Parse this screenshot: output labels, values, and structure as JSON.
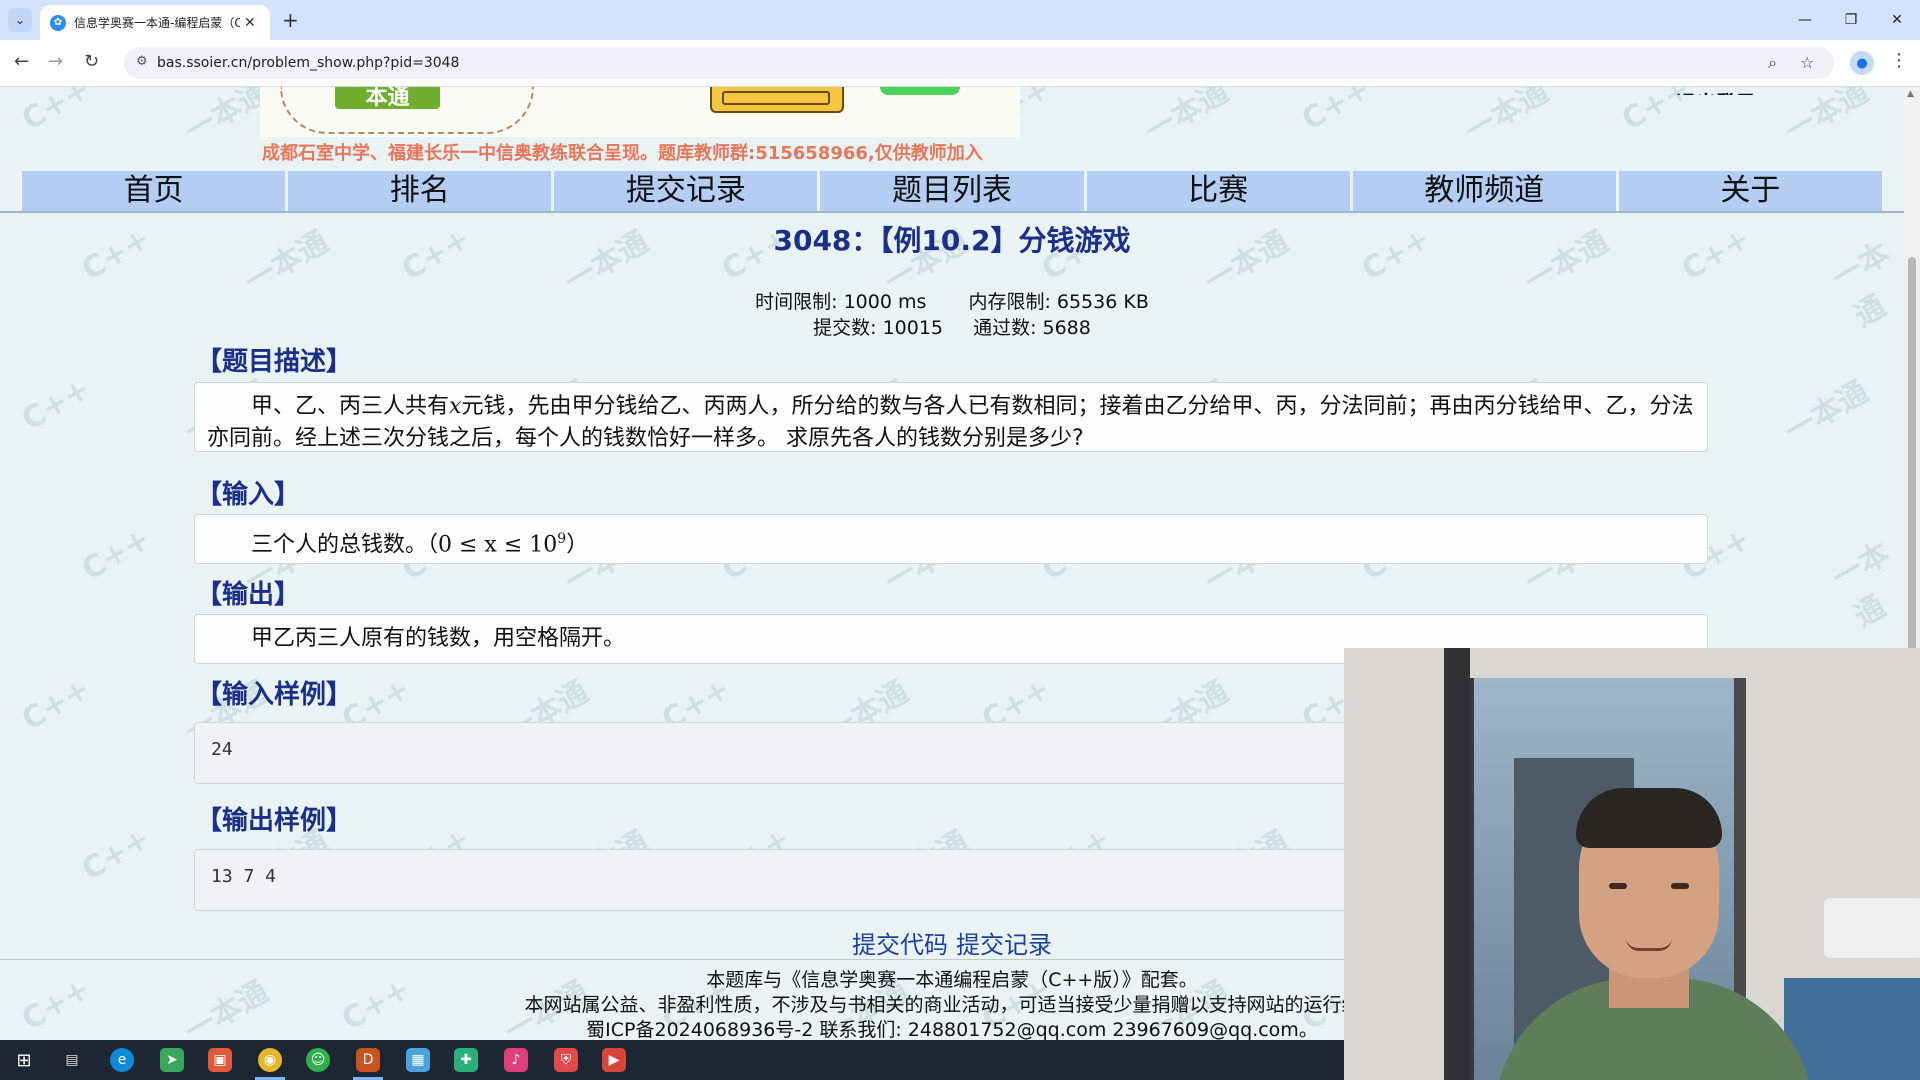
{
  "browser": {
    "tab_title": "信息学奥赛一本通-编程启蒙（C",
    "url": "bas.ssoier.cn/problem_show.php?pid=3048"
  },
  "banner": {
    "logo_text": "本通",
    "logout": "退出登录",
    "notice": "成都石室中学、福建长乐一中信奥教练联合呈现。题库教师群:515658966,仅供教师加入"
  },
  "nav": {
    "items": [
      "首页",
      "排名",
      "提交记录",
      "题目列表",
      "比赛",
      "教师频道",
      "关于"
    ]
  },
  "watermark": {
    "text_a": "C++",
    "text_b": "一本通"
  },
  "problem": {
    "title": "3048：【例10.2】分钱游戏",
    "time_limit": "时间限制: 1000 ms",
    "memory_limit": "内存限制: 65536 KB",
    "submissions": "提交数: 10015",
    "accepted": "通过数: 5688",
    "desc_head": "【题目描述】",
    "desc_1": "甲、乙、丙三人共有",
    "desc_var": "x",
    "desc_2": "元钱，先由甲分钱给乙、丙两人，所分给的数与各人已有数相同；接着由乙分给甲、丙，分法同前；再由丙分钱给甲、乙，分法亦同前。经上述三次分钱之后，每个人的钱数恰好一样多。 求原先各人的钱数分别是多少?",
    "input_head": "【输入】",
    "input_text": "三个人的总钱数。",
    "input_math": "（0 ≤ x ≤ 10",
    "input_exp": "9",
    "input_close": "）",
    "output_head": "【输出】",
    "output_text": "甲乙丙三人原有的钱数，用空格隔开。",
    "sample_in_head": "【输入样例】",
    "sample_in": "24",
    "sample_out_head": "【输出样例】",
    "sample_out": "13 7 4"
  },
  "links": {
    "submit": "提交代码",
    "records": "提交记录"
  },
  "footer": {
    "line1": "本题库与《信息学奥赛一本通编程启蒙（C++版）》配套。",
    "line2": "本网站属公益、非盈利性质，不涉及与书相关的商业活动，可适当接受少量捐赠以支持网站的运行维护",
    "line3": "蜀ICP备2024068936号-2  联系我们: 248801752@qq.com  23967609@qq.com。"
  },
  "taskbar": {
    "icons": [
      "start-icon",
      "task-view-icon",
      "edge-icon",
      "send-icon",
      "office-icon",
      "chrome-icon",
      "wechat-icon",
      "dev-cpp-icon",
      "calendar-icon",
      "app-icon",
      "music-icon",
      "shield-icon",
      "slides-icon"
    ]
  }
}
